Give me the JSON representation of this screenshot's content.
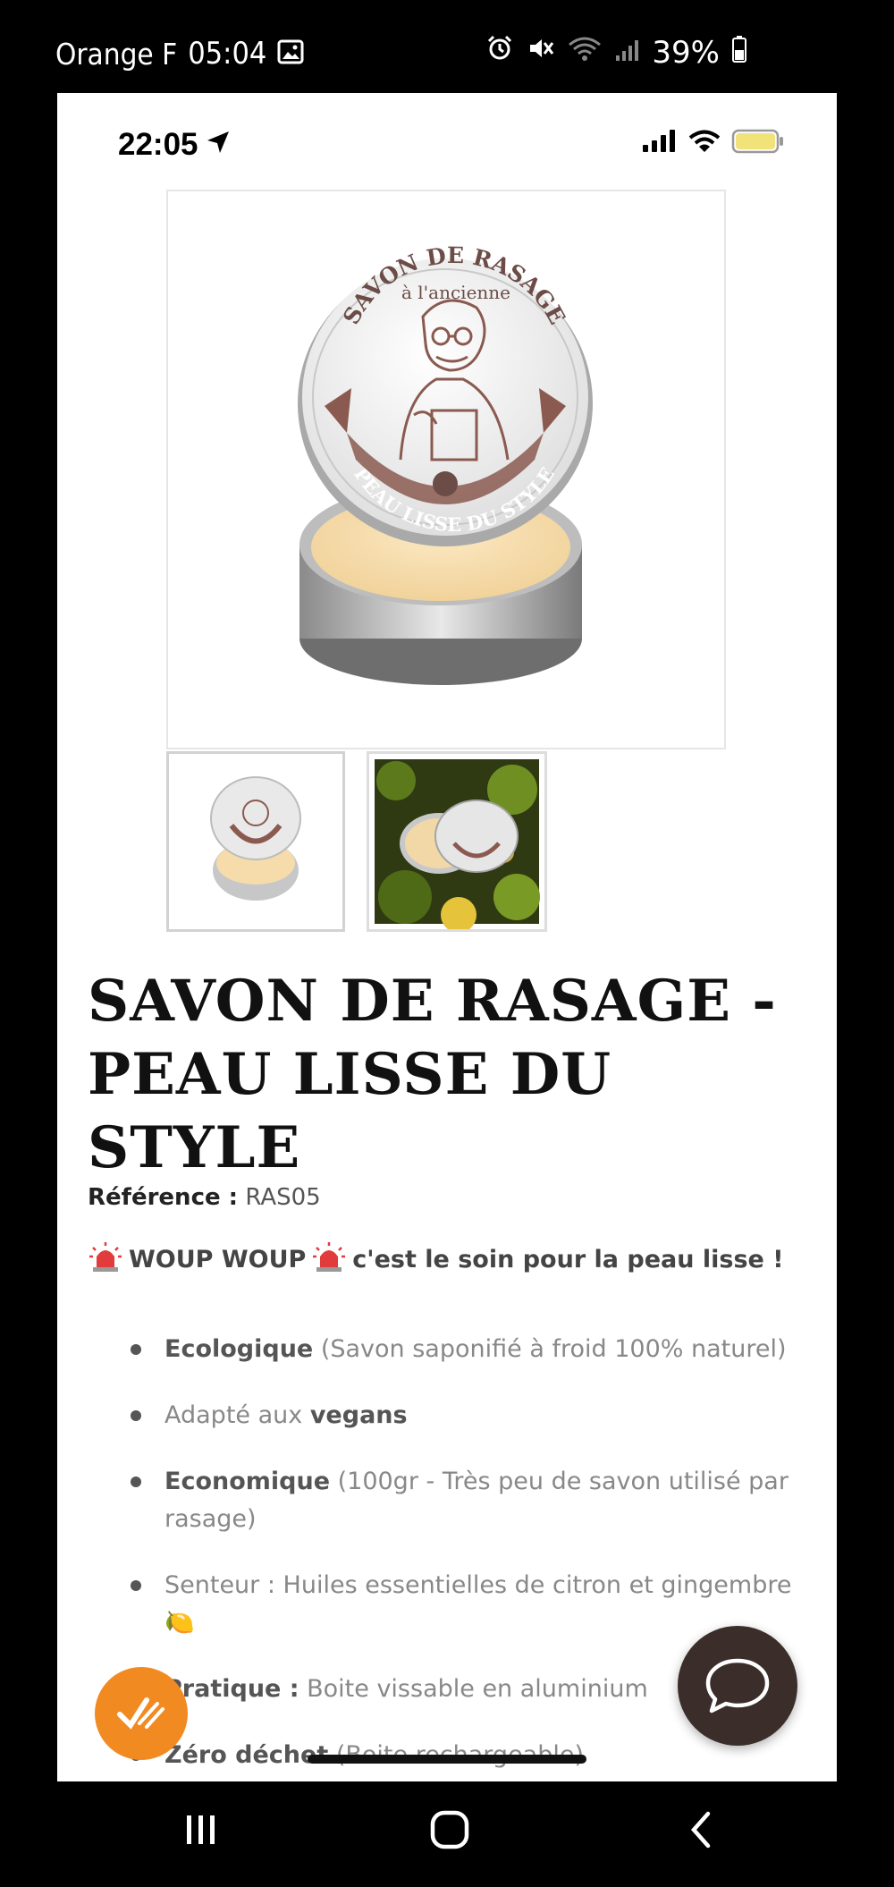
{
  "android_status": {
    "carrier": "Orange F",
    "time": "05:04",
    "battery": "39%"
  },
  "ios_status": {
    "time": "22:05"
  },
  "product": {
    "title": "SAVON DE RASAGE - PEAU LISSE DU STYLE",
    "reference_label": "Référence :",
    "reference_value": "RAS05",
    "tagline_1": "WOUP WOUP",
    "tagline_2": "c'est le soin pour la peau lisse  !",
    "tin_lid_top": "SAVON DE RASAGE",
    "tin_lid_sub": "à l'ancienne",
    "tin_lid_bottom": "PEAU LISSE DU STYLE",
    "features": [
      {
        "bold": "Ecologique",
        "text": " (Savon saponifié à froid 100% naturel)"
      },
      {
        "pre": "Adapté aux ",
        "bold": "vegans"
      },
      {
        "bold": "Economique",
        "text": " (100gr - Très peu de savon utilisé par rasage)"
      },
      {
        "pre": "Senteur : Huiles essentielles de citron et gingembre",
        "emoji": "🍋"
      },
      {
        "bold": "Pratique :",
        "text": " Boite vissable en aluminium"
      },
      {
        "bold": "Zéro déchet",
        "text": " (Boite rechargeable)"
      }
    ]
  },
  "colors": {
    "accent_orange": "#f28a22",
    "chat_button": "#3b2e2a",
    "emblem_brown": "#8a5a50"
  }
}
